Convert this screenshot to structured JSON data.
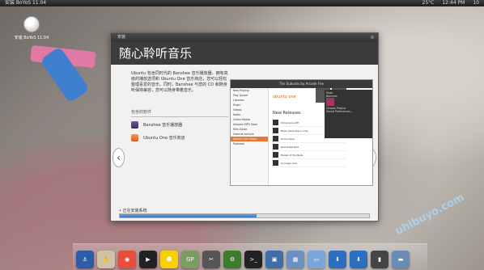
{
  "topbar": {
    "title": "安装 BoYoS 11.04",
    "tray": [
      "25°C",
      "12:44 PM",
      "10"
    ]
  },
  "desktop_icon": {
    "label": "安装 BoYoS 11.04"
  },
  "watermark": "uhibuyo.com",
  "window": {
    "titlebar": "安装",
    "header_title": "随心聆听音乐",
    "description": "Ubuntu 包含同时代的 Banshee 音乐播放器，拥有高级的播放选项和 Ubuntu One 音乐商店，您可以轻松整理喜爱的音乐。同时，Banshee 与您的 CD 和随身听保持兼容，您可以随身带着音乐。",
    "included_title": "包含的软件",
    "apps": [
      {
        "label": "Banshee 音乐播放器"
      },
      {
        "label": "Ubuntu One 音乐商店"
      }
    ],
    "nav_prev": "‹",
    "nav_next": "›",
    "screenshot": {
      "window_title": "The Suburbs by Arcade Fire",
      "brand": "ubuntu one",
      "section": "New Releases",
      "sidebar": [
        "Now Playing",
        "Play Queue",
        "Libraries",
        "Music",
        "Videos",
        "Radio",
        "Online Media",
        "Amazon MP3 Store",
        "Miro Guide",
        "Internet Archive",
        "Ubuntu One Music",
        "Podcasts"
      ],
      "releases": [
        "Dimensions EP",
        "Black Devil Disco Club",
        "Some Devil",
        "Red Bullet Red",
        "Ballad of the Bells",
        "Courage Lost"
      ],
      "popup_items": [
        "Mute",
        "Banshee",
        "Choose Playlist",
        "Sound Preferences..."
      ]
    },
    "progress_label": "• 正在安装系统",
    "progress_value": 0.55
  },
  "dock": {
    "items": [
      {
        "icon": "anchor-icon",
        "glyph": "⚓"
      },
      {
        "icon": "hands-icon",
        "glyph": "✋"
      },
      {
        "icon": "chrome-icon",
        "glyph": "◉"
      },
      {
        "icon": "media-player-icon",
        "glyph": "▶"
      },
      {
        "icon": "qq-icon",
        "glyph": "☻"
      },
      {
        "icon": "gp-icon",
        "glyph": "GP"
      },
      {
        "icon": "tools-icon",
        "glyph": "✂"
      },
      {
        "icon": "settings-icon",
        "glyph": "⚙"
      },
      {
        "icon": "terminal-icon",
        "glyph": ">_"
      },
      {
        "icon": "image-viewer-icon",
        "glyph": "▣"
      },
      {
        "icon": "calendar-icon",
        "glyph": "▦"
      },
      {
        "icon": "folder-icon",
        "glyph": "▭"
      },
      {
        "icon": "download-icon",
        "glyph": "⬇"
      },
      {
        "icon": "install-icon",
        "glyph": "⬇"
      },
      {
        "icon": "phone-icon",
        "glyph": "▮"
      },
      {
        "icon": "window-icon",
        "glyph": "▬"
      }
    ]
  }
}
